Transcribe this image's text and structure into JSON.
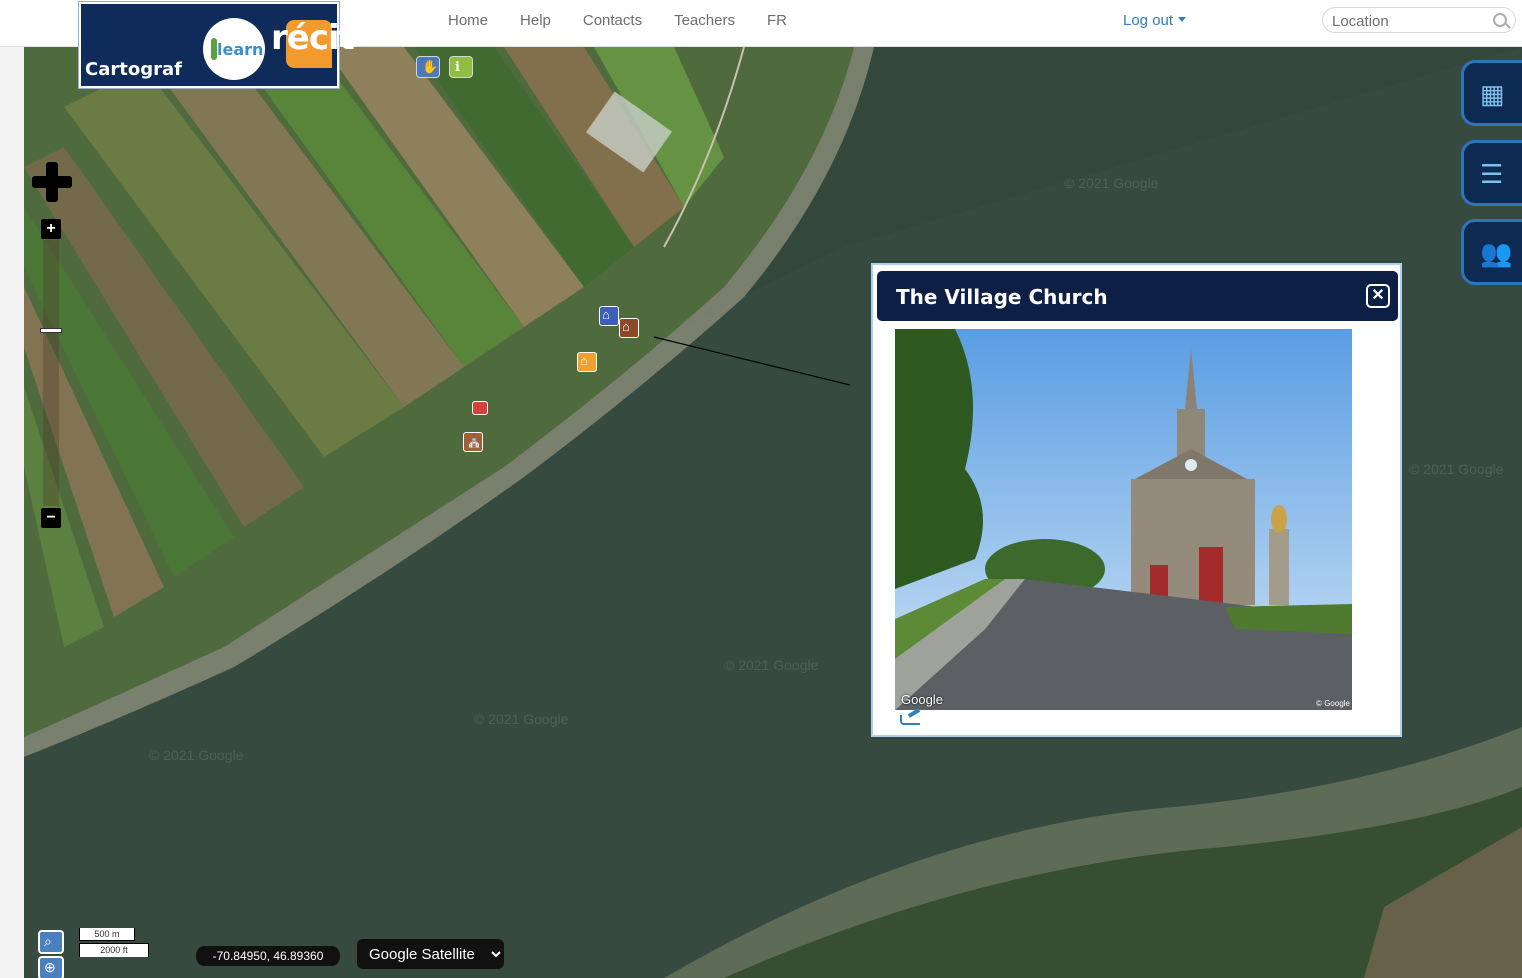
{
  "header": {
    "brand_name": "Cartograf",
    "learn_logo": "learn",
    "recit_logo": "récit",
    "nav": [
      "Home",
      "Help",
      "Contacts",
      "Teachers",
      "FR"
    ],
    "logout_label": "Log out",
    "search_placeholder": "Location"
  },
  "toolbar": {
    "icons": [
      "hand-icon",
      "info-icon"
    ]
  },
  "map": {
    "zoom_in_label": "+",
    "zoom_out_label": "−",
    "zoom_level_fraction": 0.33,
    "markers": [
      "blue-house-icon",
      "brown-house-icon",
      "orange-house-icon",
      "red-roof-icon",
      "church-icon"
    ],
    "watermark": "© 2021 Google"
  },
  "popup": {
    "title": "The Village Church",
    "close_icon": "close-icon",
    "photo_watermark": "Google",
    "photo_copyright": "© Google"
  },
  "side_panel": {
    "buttons": [
      "map-layers-icon",
      "legend-icon",
      "people-icon"
    ]
  },
  "footer": {
    "scale_metric": "500 m",
    "scale_imperial": "2000 ft",
    "coordinates": "-70.84950, 46.89360",
    "basemap_selected": "Google Satellite",
    "basemap_options": [
      "Google Satellite"
    ]
  },
  "colors": {
    "header_bg": "#ffffff",
    "nav_text": "#6b6f73",
    "link_blue": "#2f7fc1",
    "popup_header": "#0d1f45",
    "logo_bg": "#0f2b5a",
    "river": "#34473b"
  }
}
